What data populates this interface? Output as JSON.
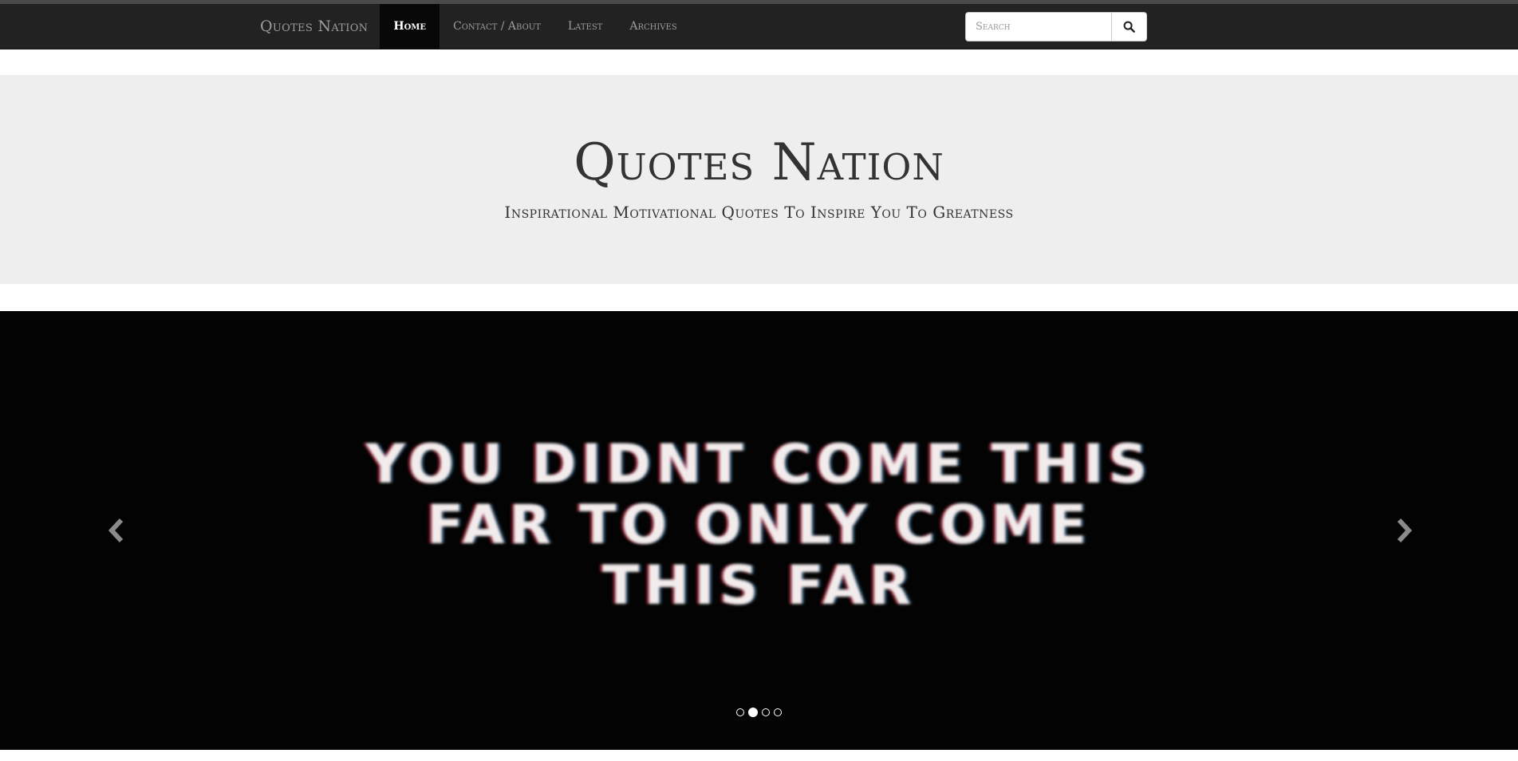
{
  "navbar": {
    "brand": "Quotes Nation",
    "links": [
      {
        "label": "Home",
        "active": true
      },
      {
        "label": "Contact / About",
        "active": false
      },
      {
        "label": "Latest",
        "active": false
      },
      {
        "label": "Archives",
        "active": false
      }
    ],
    "search": {
      "placeholder": "Search",
      "value": "",
      "icon": "search-icon"
    }
  },
  "hero": {
    "title": "Quotes Nation",
    "subtitle": "Inspirational Motivational Quotes To Inspire You To Greatness"
  },
  "carousel": {
    "slide_lines": [
      "YOU DIDNT COME THIS",
      "FAR TO ONLY COME",
      "THIS FAR"
    ],
    "prev_icon": "chevron-left-icon",
    "next_icon": "chevron-right-icon",
    "indicator_count": 4,
    "active_indicator": 2
  },
  "colors": {
    "navbar_bg": "#222222",
    "nav_active_bg": "#080808",
    "hero_bg": "#eeeeee",
    "carousel_bg": "#030303"
  }
}
